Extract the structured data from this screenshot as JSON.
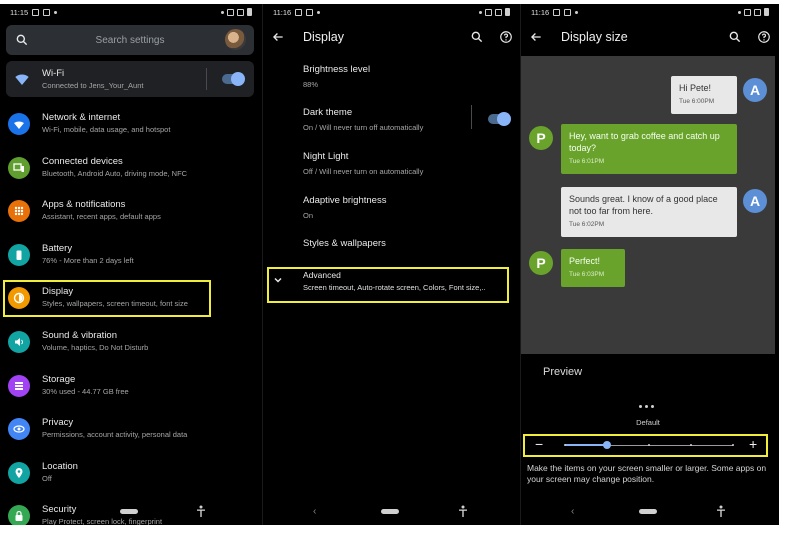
{
  "colors": {
    "highlight": "#f0ee3a",
    "toggle_on": "#8ab4f8",
    "bubble_green": "#6aa32b",
    "avatar_blue": "#5c8fd6"
  },
  "status": {
    "time_1": "11:15",
    "time_2": "11:16",
    "time_3": "11:16"
  },
  "settings": {
    "search_placeholder": "Search settings",
    "wifi": {
      "title": "Wi-Fi",
      "subtitle": "Connected to Jens_Your_Aunt",
      "toggle_on": true
    },
    "items": [
      {
        "title": "Network & internet",
        "subtitle": "Wi-Fi, mobile, data usage, and hotspot",
        "icon": "wifi-icon",
        "color": "#1a73e8"
      },
      {
        "title": "Connected devices",
        "subtitle": "Bluetooth, Android Auto, driving mode, NFC",
        "icon": "devices-icon",
        "color": "#5f9e2f"
      },
      {
        "title": "Apps & notifications",
        "subtitle": "Assistant, recent apps, default apps",
        "icon": "apps-icon",
        "color": "#e8710a"
      },
      {
        "title": "Battery",
        "subtitle": "76% - More than 2 days left",
        "icon": "battery-icon",
        "color": "#12a3a3"
      },
      {
        "title": "Display",
        "subtitle": "Styles, wallpapers, screen timeout, font size",
        "icon": "brightness-icon",
        "color": "#f29900"
      },
      {
        "title": "Sound & vibration",
        "subtitle": "Volume, haptics, Do Not Disturb",
        "icon": "volume-icon",
        "color": "#12a3a3"
      },
      {
        "title": "Storage",
        "subtitle": "30% used - 44.77 GB free",
        "icon": "storage-icon",
        "color": "#a142f4"
      },
      {
        "title": "Privacy",
        "subtitle": "Permissions, account activity, personal data",
        "icon": "privacy-icon",
        "color": "#4285f4"
      },
      {
        "title": "Location",
        "subtitle": "Off",
        "icon": "location-icon",
        "color": "#12a3a3"
      },
      {
        "title": "Security",
        "subtitle": "Play Protect, screen lock, fingerprint",
        "icon": "lock-icon",
        "color": "#34a853"
      }
    ]
  },
  "display": {
    "title": "Display",
    "items": [
      {
        "title": "Brightness level",
        "subtitle": "88%"
      },
      {
        "title": "Dark theme",
        "subtitle": "On / Will never turn off automatically",
        "toggle_on": true
      },
      {
        "title": "Night Light",
        "subtitle": "Off / Will never turn on automatically"
      },
      {
        "title": "Adaptive brightness",
        "subtitle": "On"
      },
      {
        "title": "Styles & wallpapers",
        "subtitle": ""
      },
      {
        "title": "Advanced",
        "subtitle": "Screen timeout, Auto-rotate screen, Colors, Font size,.."
      }
    ]
  },
  "display_size": {
    "title": "Display size",
    "messages": [
      {
        "text": "Hi Pete!",
        "time": "Tue 6:00PM",
        "avatar": "A",
        "side": "right"
      },
      {
        "text": "Hey, want to grab coffee and catch up today?",
        "time": "Tue 6:01PM",
        "avatar": "P",
        "side": "left"
      },
      {
        "text": "Sounds great. I know of a good place not too far from here.",
        "time": "Tue 6:02PM",
        "avatar": "A",
        "side": "right"
      },
      {
        "text": "Perfect!",
        "time": "Tue 6:03PM",
        "avatar": "P",
        "side": "left"
      }
    ],
    "preview_label": "Preview",
    "slider_label": "Default",
    "slider_steps": 5,
    "slider_value": 2,
    "minus": "−",
    "plus": "+",
    "help_text": "Make the items on your screen smaller or larger. Some apps on your screen may change position."
  }
}
